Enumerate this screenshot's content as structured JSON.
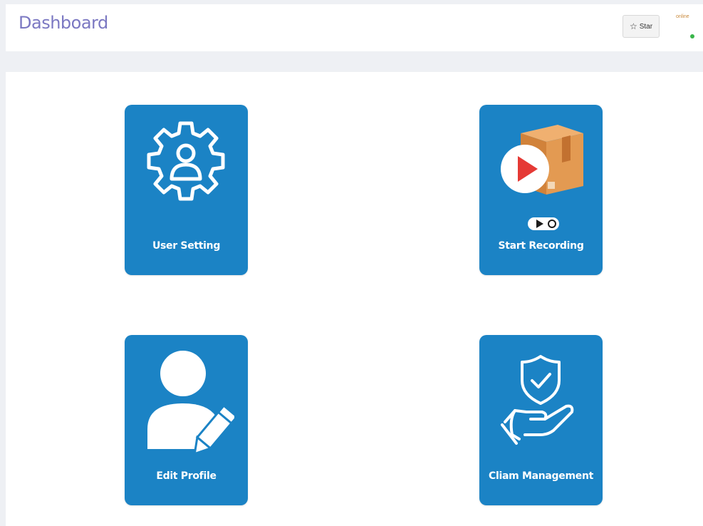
{
  "header": {
    "title": "Dashboard",
    "star_label": "Star",
    "user_label": "online",
    "status_color": "#39b54a"
  },
  "tiles": [
    {
      "label": "User Setting",
      "icon": "gear-user-icon"
    },
    {
      "label": "Start Recording",
      "icon": "video-box-icon"
    },
    {
      "label": "Edit Profile",
      "icon": "user-edit-icon"
    },
    {
      "label": "Cliam Management",
      "icon": "shield-hand-icon"
    }
  ],
  "colors": {
    "tile": "#1b83c5",
    "title": "#7b78c2",
    "background": "#eef0f4"
  }
}
